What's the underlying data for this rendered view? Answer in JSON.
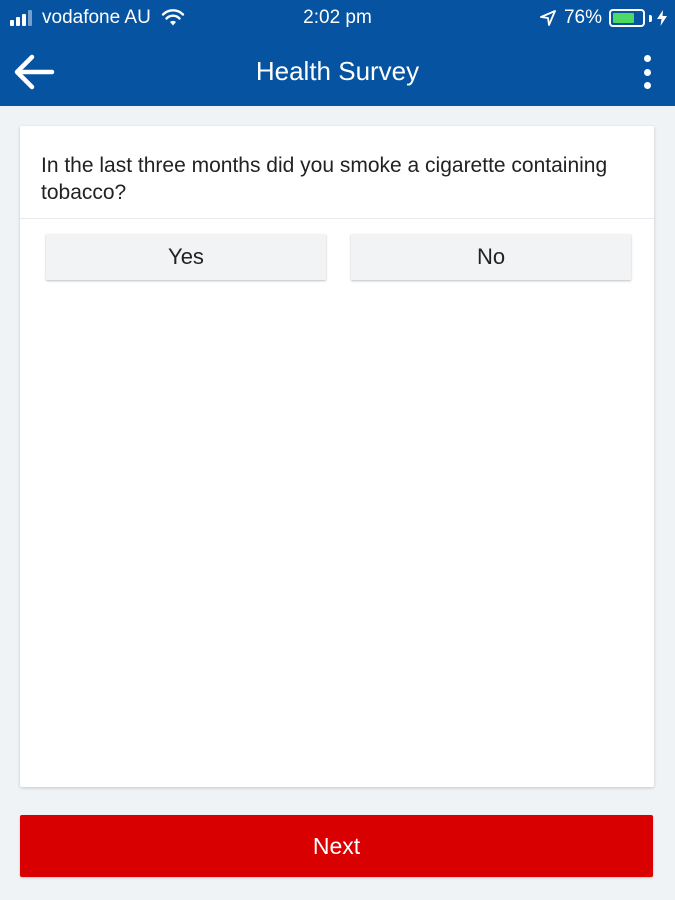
{
  "status_bar": {
    "carrier": "vodafone AU",
    "time": "2:02 pm",
    "battery_percent": "76%",
    "battery_level": 0.76,
    "signal_bars_filled": 3,
    "icons": [
      "signal-icon",
      "wifi-icon",
      "location-arrow-icon",
      "battery-icon",
      "charging-bolt-icon"
    ]
  },
  "app_bar": {
    "title": "Health Survey",
    "back_icon": "back-arrow-icon",
    "menu_icon": "more-vertical-icon"
  },
  "survey": {
    "question": "In the last three months did you smoke a cigarette containing tobacco?",
    "options": [
      "Yes",
      "No"
    ]
  },
  "footer": {
    "next_label": "Next"
  },
  "colors": {
    "header": "#0553a1",
    "next_button": "#d80000",
    "background": "#f0f3f6",
    "battery_fill": "#4cd964"
  }
}
